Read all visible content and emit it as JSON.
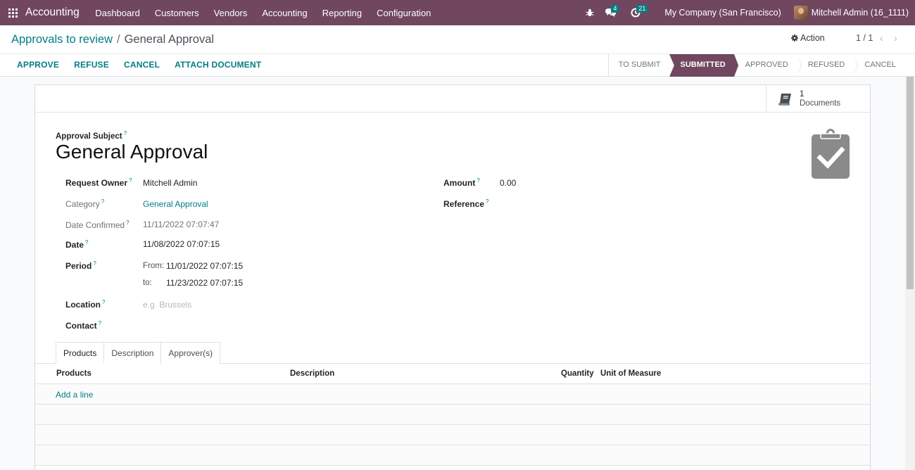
{
  "navbar": {
    "app_name": "Accounting",
    "menu": [
      "Dashboard",
      "Customers",
      "Vendors",
      "Accounting",
      "Reporting",
      "Configuration"
    ],
    "messages_badge": "4",
    "activities_badge": "21",
    "company": "My Company (San Francisco)",
    "user": "Mitchell Admin (16_1111)"
  },
  "breadcrumb": {
    "parent": "Approvals to review",
    "separator": "/",
    "current": "General Approval"
  },
  "control": {
    "action_label": "Action",
    "pager": "1 / 1",
    "pager_prev": "‹",
    "pager_next": "›",
    "buttons": [
      "APPROVE",
      "REFUSE",
      "CANCEL",
      "ATTACH DOCUMENT"
    ]
  },
  "statusbar": {
    "stages": [
      "TO SUBMIT",
      "SUBMITTED",
      "APPROVED",
      "REFUSED",
      "CANCEL"
    ],
    "active": "SUBMITTED"
  },
  "smart_button": {
    "count": "1",
    "label": "Documents"
  },
  "form": {
    "subject_label": "Approval Subject",
    "title": "General Approval",
    "help_mark": "?",
    "request_owner_label": "Request Owner",
    "request_owner": "Mitchell Admin",
    "category_label": "Category",
    "category": "General Approval",
    "date_confirmed_label": "Date Confirmed",
    "date_confirmed": "11/11/2022 07:07:47",
    "date_label": "Date",
    "date": "11/08/2022 07:07:15",
    "period_label": "Period",
    "from_label": "From:",
    "period_from": "11/01/2022 07:07:15",
    "to_label": "to:",
    "period_to": "11/23/2022 07:07:15",
    "location_label": "Location",
    "location_placeholder": "e.g. Brussels",
    "contact_label": "Contact",
    "amount_label": "Amount",
    "amount": "0.00",
    "reference_label": "Reference"
  },
  "tabs": [
    "Products",
    "Description",
    "Approver(s)"
  ],
  "table": {
    "columns": [
      "Products",
      "Description",
      "Quantity",
      "Unit of Measure"
    ],
    "add_line": "Add a line"
  },
  "colors": {
    "brand": "#71465f",
    "accent": "#017e84"
  }
}
